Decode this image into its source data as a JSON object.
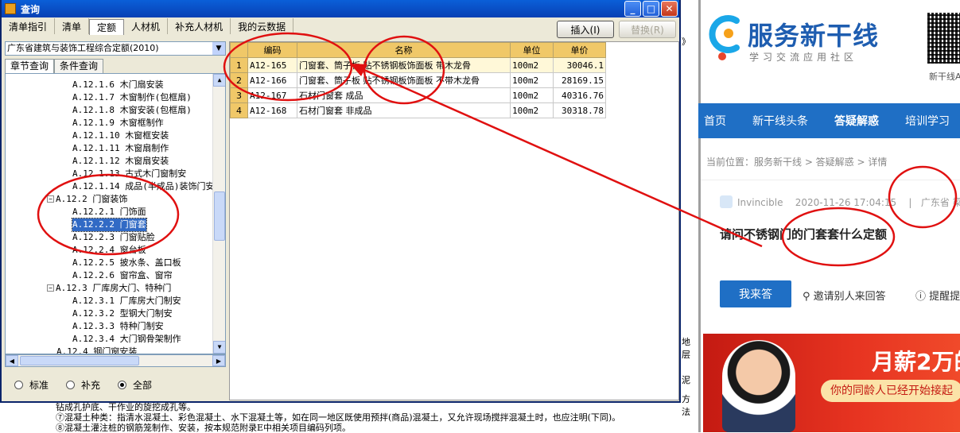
{
  "window": {
    "title": "查询",
    "tabs": [
      "清单指引",
      "清单",
      "定额",
      "人材机",
      "补充人材机",
      "我的云数据"
    ],
    "active_tab": "定额",
    "insert_button": "插入(I)",
    "replace_button": "替换(R)"
  },
  "library_select": {
    "value": "广东省建筑与装饰工程综合定额(2010)"
  },
  "query_tabs": [
    "章节查询",
    "条件查询"
  ],
  "tree": [
    {
      "label": "A.12.1.6 木门扇安装"
    },
    {
      "label": "A.12.1.7 木窗制作(包框扇)"
    },
    {
      "label": "A.12.1.8 木窗安装(包框扇)"
    },
    {
      "label": "A.12.1.9 木窗框制作"
    },
    {
      "label": "A.12.1.10 木窗框安装"
    },
    {
      "label": "A.12.1.11 木窗扇制作"
    },
    {
      "label": "A.12.1.12 木窗扇安装"
    },
    {
      "label": "A.12.1.13 古式木门窗制安"
    },
    {
      "label": "A.12.1.14 成品(半成品)装饰门安"
    },
    {
      "label": "A.12.2 门窗装饰"
    },
    {
      "label": "A.12.2.1 门饰面"
    },
    {
      "label": "A.12.2.2 门窗套"
    },
    {
      "label": "A.12.2.3 门窗贴脸"
    },
    {
      "label": "A.12.2.4 窗台板"
    },
    {
      "label": "A.12.2.5 披水条、盖口板"
    },
    {
      "label": "A.12.2.6 窗帘盒、窗帘"
    },
    {
      "label": "A.12.3 厂库房大门、特种门"
    },
    {
      "label": "A.12.3.1 厂库房大门制安"
    },
    {
      "label": "A.12.3.2 型钢大门制安"
    },
    {
      "label": "A.12.3.3 特种门制安"
    },
    {
      "label": "A.12.3.4 大门钢骨架制作"
    },
    {
      "label": "A.12.4 钢门窗安装"
    }
  ],
  "radio_options": [
    "标准",
    "补充",
    "全部"
  ],
  "radio_selected": "全部",
  "grid": {
    "headers": [
      "编码",
      "名称",
      "单位",
      "单价"
    ],
    "rows": [
      {
        "num": "1",
        "code": "A12-165",
        "name": "门窗套、筒子板 贴不锈钢板饰面板  带木龙骨",
        "unit": "100m2",
        "price": "30046.1"
      },
      {
        "num": "2",
        "code": "A12-166",
        "name": "门窗套、筒子板 贴不锈钢板饰面板  不带木龙骨",
        "unit": "100m2",
        "price": "28169.15"
      },
      {
        "num": "3",
        "code": "A12-167",
        "name": "石材门窗套 成品",
        "unit": "100m2",
        "price": "40316.76"
      },
      {
        "num": "4",
        "code": "A12-168",
        "name": "石材门窗套 非成品",
        "unit": "100m2",
        "price": "30318.78"
      }
    ]
  },
  "background_doc": {
    "line1": "钻成孔护底、干作业的旋挖成孔等。",
    "line2": "⑦混凝土种类：指清水混凝土、彩色混凝土、水下混凝土等，如在同一地区既使用预拌(商品)混凝土，又允许现场搅拌混凝土时，也应注明(下同)。",
    "line3": "⑧混凝土灌注桩的钢筋笼制作、安装，按本规范附录E中相关项目编码列项。",
    "right_frag1": "》",
    "right_frag2": "地层",
    "right_frag3": "泥",
    "right_frag4": "方法"
  },
  "website": {
    "logo_title": "服务新干线",
    "logo_sub": "学习交流应用社区",
    "qr_caption": "新干线A",
    "nav": [
      "首页",
      "新干线头条",
      "答疑解惑",
      "培训学习"
    ],
    "nav_current": "答疑解惑",
    "breadcrumb": "当前位置：服务新干线 > 答疑解惑 > 详情",
    "author": "Invincible",
    "datetime": "2020-11-26 17:04:15",
    "location": "广东省 梁",
    "question": "请问不锈钢门的门套套什么定额",
    "answer_button": "我来答",
    "invite": "邀请别人来回答",
    "tip": "提醒提",
    "ad_headline": "月薪2万的",
    "ad_sub": "你的同龄人已经开始接起"
  },
  "colors": {
    "title_bar": "#0a5fd8",
    "annotation": "#e01010",
    "nav_blue": "#1f6fc5",
    "grid_header": "#f0c868"
  }
}
